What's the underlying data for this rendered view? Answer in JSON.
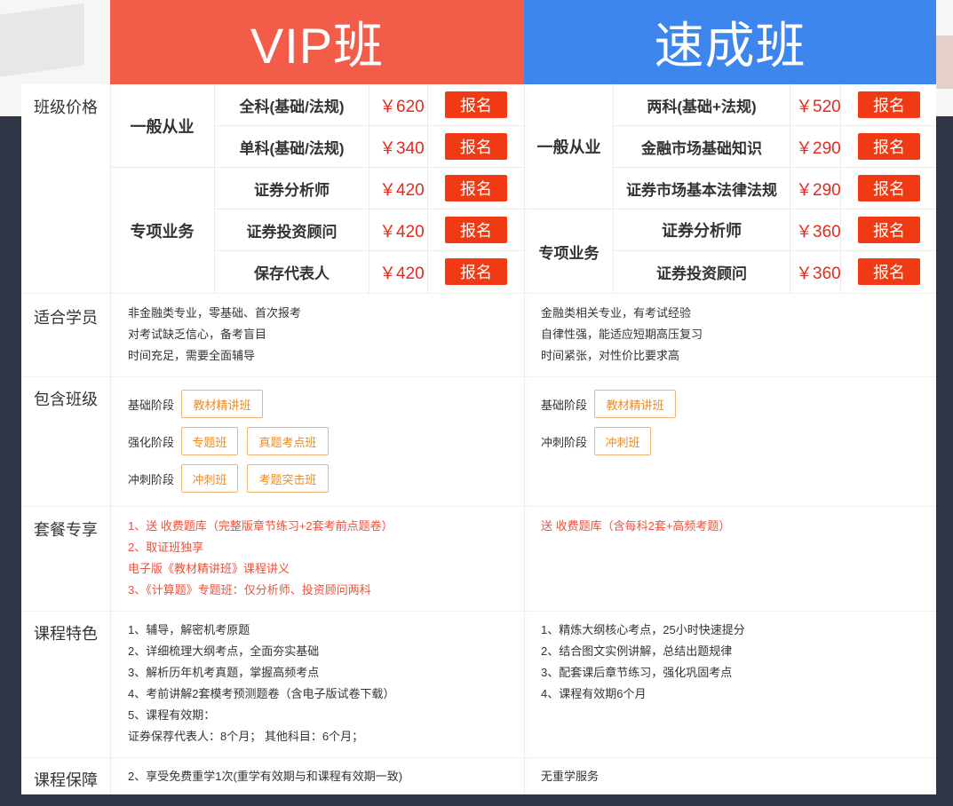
{
  "header": {
    "vip": "VIP班",
    "fast": "速成班"
  },
  "row_labels": {
    "price": "班级价格",
    "students": "适合学员",
    "classes": "包含班级",
    "package": "套餐专享",
    "features": "课程特色",
    "guarantee": "课程保障"
  },
  "vip": {
    "cat1": "一般从业",
    "cat2": "专项业务",
    "items": [
      {
        "name": "全科(基础/法规)",
        "price": "￥620",
        "btn": "报名"
      },
      {
        "name": "单科(基础/法规)",
        "price": "￥340",
        "btn": "报名"
      },
      {
        "name": "证券分析师",
        "price": "￥420",
        "btn": "报名"
      },
      {
        "name": "证券投资顾问",
        "price": "￥420",
        "btn": "报名"
      },
      {
        "name": "保存代表人",
        "price": "￥420",
        "btn": "报名"
      }
    ],
    "students": [
      "非金融类专业，零基础、首次报考",
      "对考试缺乏信心，备考盲目",
      "时间充足，需要全面辅导"
    ],
    "stages": [
      {
        "label": "基础阶段",
        "tags": [
          "教材精讲班"
        ]
      },
      {
        "label": "强化阶段",
        "tags": [
          "专题班",
          "真题考点班"
        ]
      },
      {
        "label": "冲刺阶段",
        "tags": [
          "冲刺班",
          "考题突击班"
        ]
      }
    ],
    "package": [
      "1、送 收费题库（完整版章节练习+2套考前点题卷）",
      "2、取证班独享",
      "电子版《教材精讲班》课程讲义",
      "3、《计算题》专题班：仅分析师、投资顾问两科"
    ],
    "features": [
      "1、辅导，解密机考原题",
      "2、详细梳理大纲考点，全面夯实基础",
      "3、解析历年机考真题，掌握高频考点",
      "4、考前讲解2套模考预测题卷（含电子版试卷下载）",
      "5、课程有效期：",
      "证券保荐代表人：8个月； 其他科目：6个月；"
    ],
    "guarantee": "2、享受免费重学1次(重学有效期与和课程有效期一致)"
  },
  "fast": {
    "cat1": "一般从业",
    "cat2": "专项业务",
    "items": [
      {
        "name": "两科(基础+法规)",
        "price": "￥520",
        "btn": "报名"
      },
      {
        "name": "金融市场基础知识",
        "price": "￥290",
        "btn": "报名"
      },
      {
        "name": "证券市场基本法律法规",
        "price": "￥290",
        "btn": "报名"
      },
      {
        "name": "证券分析师",
        "price": "￥360",
        "btn": "报名"
      },
      {
        "name": "证券投资顾问",
        "price": "￥360",
        "btn": "报名"
      }
    ],
    "students": [
      "金融类相关专业，有考试经验",
      "自律性强，能适应短期高压复习",
      "时间紧张，对性价比要求高"
    ],
    "stages": [
      {
        "label": "基础阶段",
        "tags": [
          "教材精讲班"
        ]
      },
      {
        "label": "冲刺阶段",
        "tags": [
          "冲刺班"
        ]
      }
    ],
    "package": [
      "送 收费题库（含每科2套+高频考题）"
    ],
    "features": [
      "1、精炼大纲核心考点，25小时快速提分",
      "2、结合图文实例讲解，总结出题规律",
      "3、配套课后章节练习，强化巩固考点",
      "4、课程有效期6个月"
    ],
    "guarantee": "无重学服务"
  }
}
